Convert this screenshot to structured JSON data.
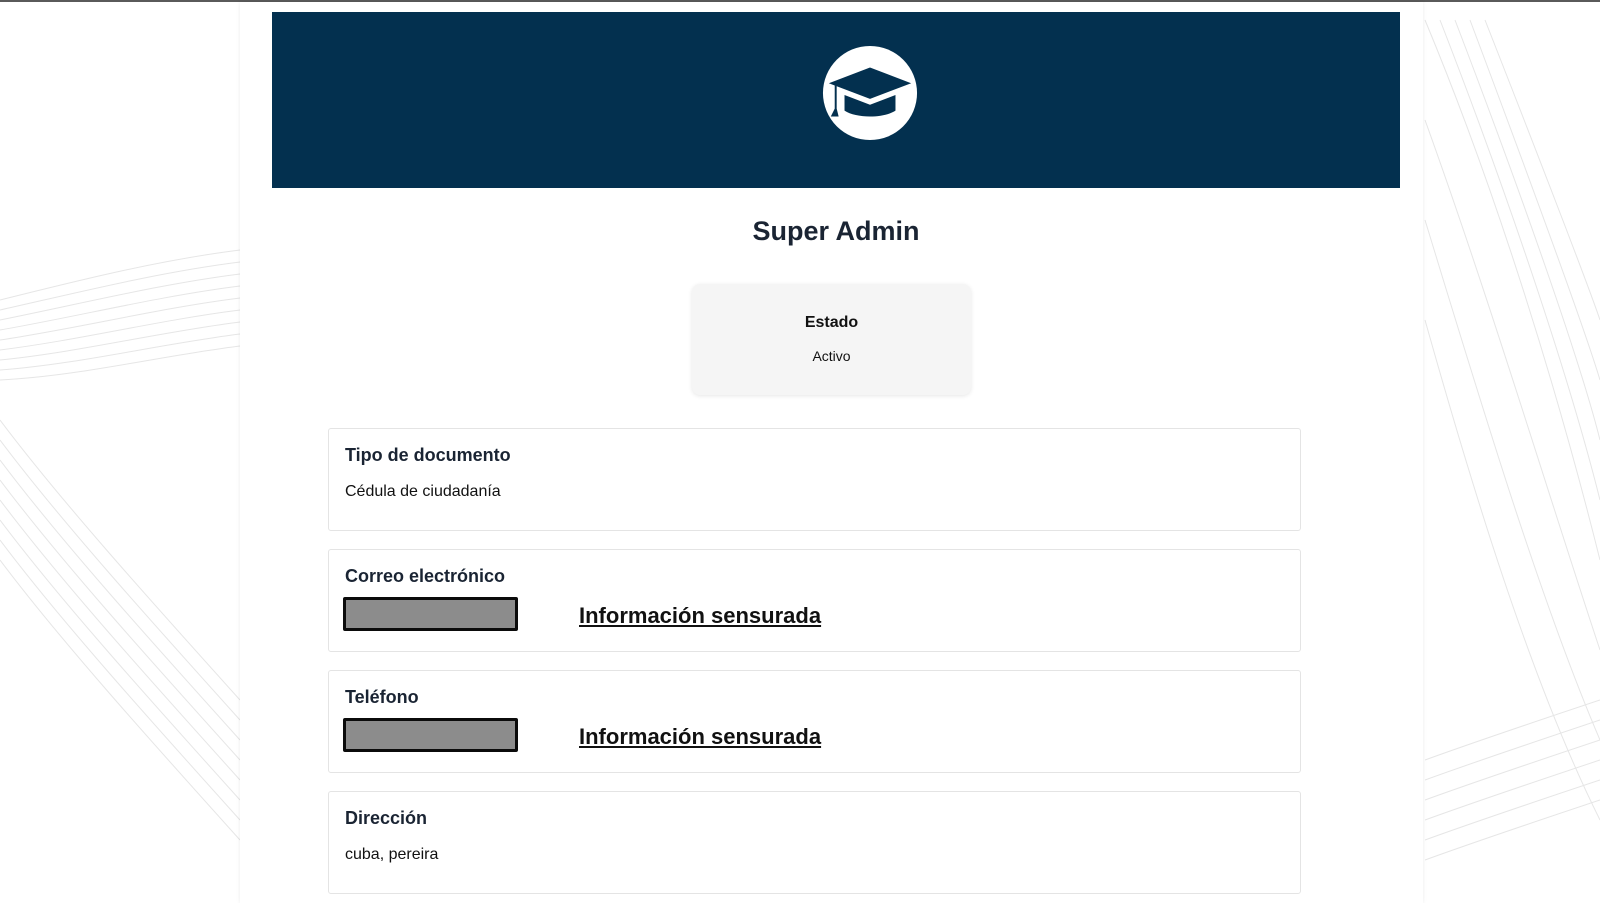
{
  "header": {
    "logo_icon": "graduation-cap-icon",
    "banner_color": "#03304f"
  },
  "profile": {
    "name": "Super Admin"
  },
  "status": {
    "label": "Estado",
    "value": "Activo"
  },
  "fields": {
    "document_type": {
      "label": "Tipo de documento",
      "value": "Cédula de ciudadanía"
    },
    "email": {
      "label": "Correo electrónico",
      "censored_text": "Información sensurada"
    },
    "phone": {
      "label": "Teléfono",
      "censored_text": "Información sensurada"
    },
    "address": {
      "label": "Dirección",
      "value": "cuba, pereira"
    }
  }
}
